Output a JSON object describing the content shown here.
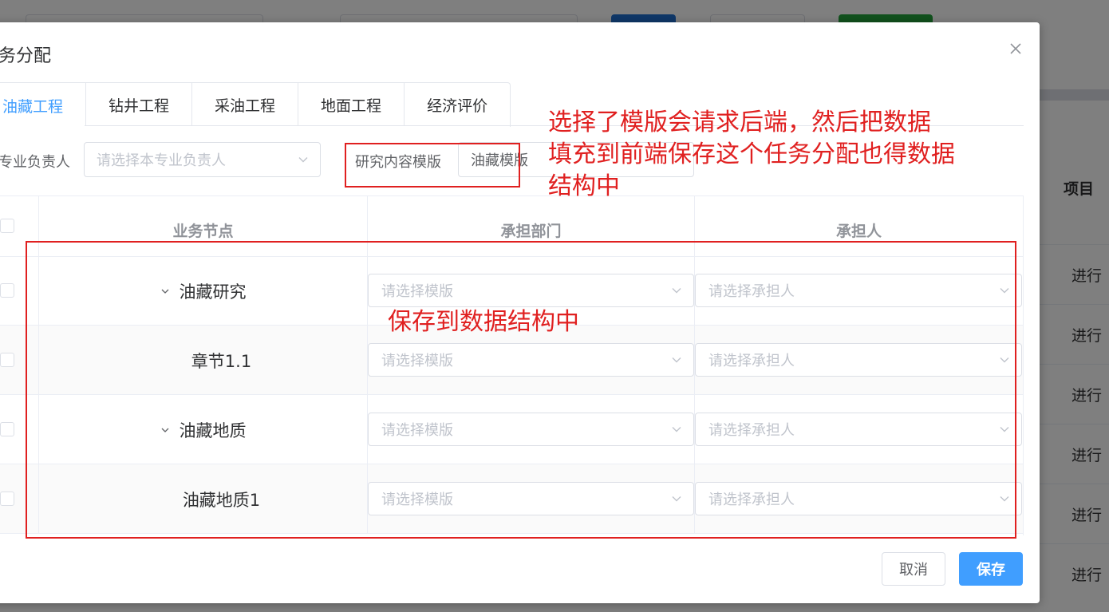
{
  "background": {
    "table_header": "项目",
    "status_cells": [
      "进行",
      "进行",
      "进行",
      "进行",
      "进行",
      "进行"
    ]
  },
  "dialog": {
    "title": "务分配",
    "tabs": [
      "油藏工程",
      "钻井工程",
      "采油工程",
      "地面工程",
      "经济评价"
    ],
    "active_tab": "油藏工程",
    "owner_label": "专业负责人",
    "owner_placeholder": "请选择本专业负责人",
    "template_label": "研究内容模版",
    "template_value": "油藏模版",
    "columns": {
      "node": "业务节点",
      "department": "承担部门",
      "assignee": "承担人"
    },
    "rows": [
      {
        "node": "油藏研究",
        "expandable": true,
        "department_placeholder": "请选择模版",
        "assignee_placeholder": "请选择承担人"
      },
      {
        "node": "章节1.1",
        "expandable": false,
        "department_placeholder": "请选择模版",
        "assignee_placeholder": "请选择承担人"
      },
      {
        "node": "油藏地质",
        "expandable": true,
        "department_placeholder": "请选择模版",
        "assignee_placeholder": "请选择承担人"
      },
      {
        "node": "油藏地质1",
        "expandable": false,
        "department_placeholder": "请选择模版",
        "assignee_placeholder": "请选择承担人"
      }
    ],
    "cancel_label": "取消",
    "save_label": "保存"
  },
  "annotations": {
    "note_top": [
      "选择了模版会请求后端，然后把数据",
      "填充到前端保存这个任务分配也得数据",
      "结构中"
    ],
    "note_middle": "保存到数据结构中",
    "color": "#e02020"
  },
  "icons": {
    "close": "close-icon",
    "dropdown": "chevron-down-icon",
    "expand": "chevron-down-icon"
  }
}
